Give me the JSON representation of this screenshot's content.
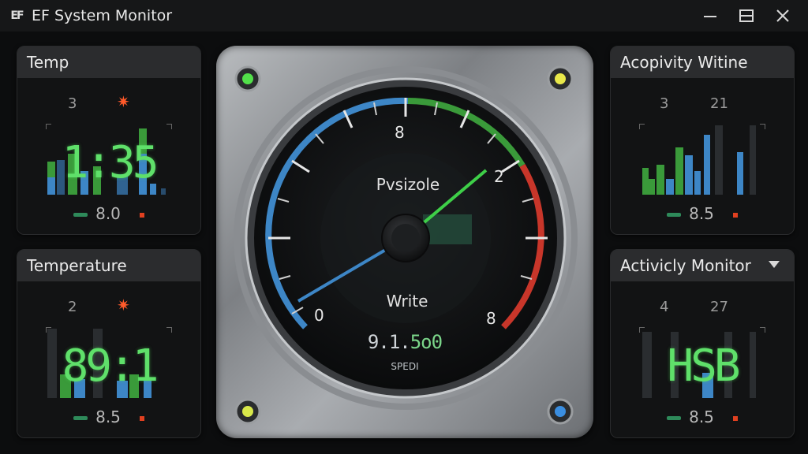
{
  "window": {
    "logo": "EF",
    "title": "EF System Monitor",
    "controls": [
      "minimize-icon",
      "maximize-icon",
      "close-icon"
    ]
  },
  "panels": {
    "top_left": {
      "title": "Temp",
      "stat_left": "3",
      "stat_right": "",
      "reading": "1:35",
      "footer_value": "8.0"
    },
    "bottom_left": {
      "title": "Temperature",
      "stat_left": "2",
      "stat_right": "",
      "reading": "89:1",
      "footer_value": "8.5"
    },
    "top_right": {
      "title": "Acopivity Witine",
      "stat_left": "3",
      "stat_right": "21",
      "reading": "",
      "footer_value": "8.5"
    },
    "bottom_right": {
      "title": "Activicly Monitor",
      "stat_left": "4",
      "stat_right": "27",
      "reading": "HSB",
      "footer_value": "8.5"
    }
  },
  "gauge": {
    "top_label": "Pvsizole",
    "bottom_label": "Write",
    "digital_prefix": "9.1.",
    "digital_value": "5o0",
    "unit_label": "SPEDI",
    "scale": {
      "min": "0",
      "top": "8",
      "right": "2",
      "max": "8"
    },
    "needle_value_fraction": 0.66,
    "indicator_lights": {
      "top_left": "green",
      "top_right": "yellow",
      "bottom_left": "yellow",
      "bottom_right": "blue"
    }
  },
  "colors": {
    "accent_green": "#4fd35c",
    "accent_blue": "#3d86c6",
    "alert_red": "#c8362a"
  }
}
